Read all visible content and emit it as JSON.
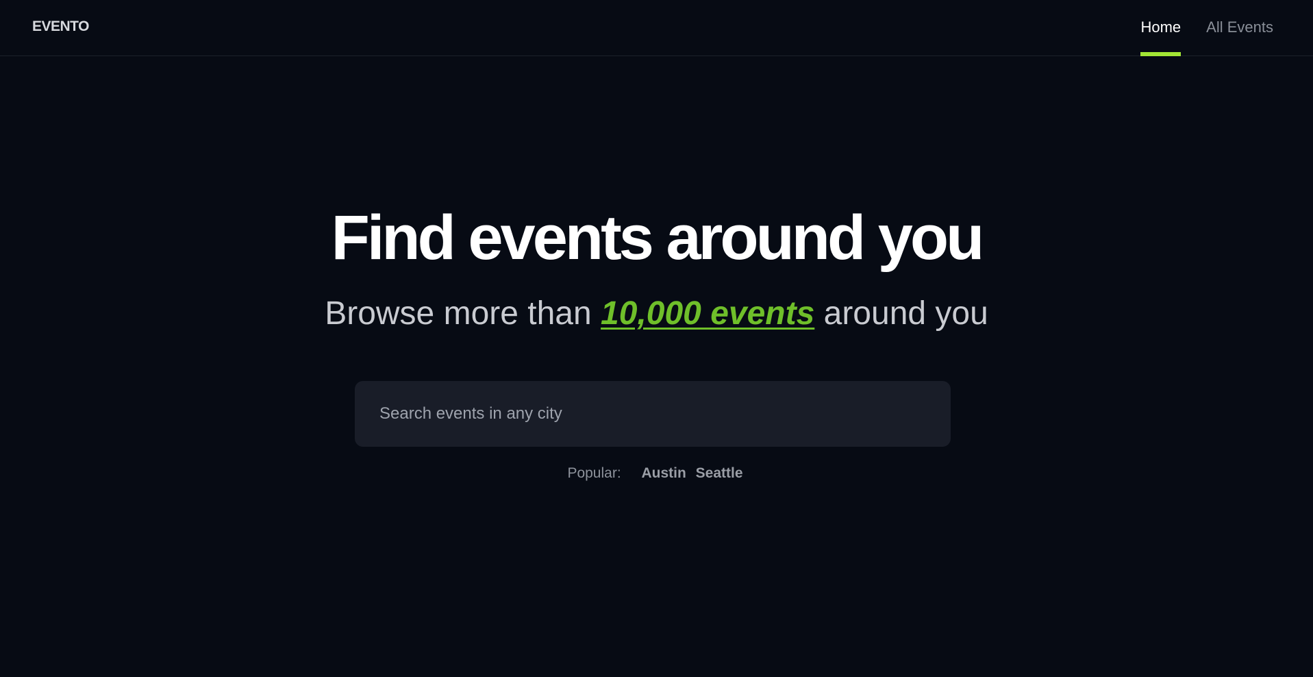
{
  "header": {
    "logo": "EVENTO",
    "nav": [
      {
        "label": "Home",
        "active": true
      },
      {
        "label": "All Events",
        "active": false
      }
    ]
  },
  "hero": {
    "title": "Find events around you",
    "subtitle_before": "Browse more than",
    "subtitle_highlight": "10,000 events",
    "subtitle_after": "around you"
  },
  "search": {
    "placeholder": "Search events in any city",
    "value": ""
  },
  "popular": {
    "label": "Popular:",
    "cities": [
      "Austin",
      "Seattle"
    ]
  },
  "colors": {
    "background": "#070b14",
    "accent": "#a3e635",
    "highlight_text": "#6fbf2a",
    "input_background": "#191d28"
  }
}
